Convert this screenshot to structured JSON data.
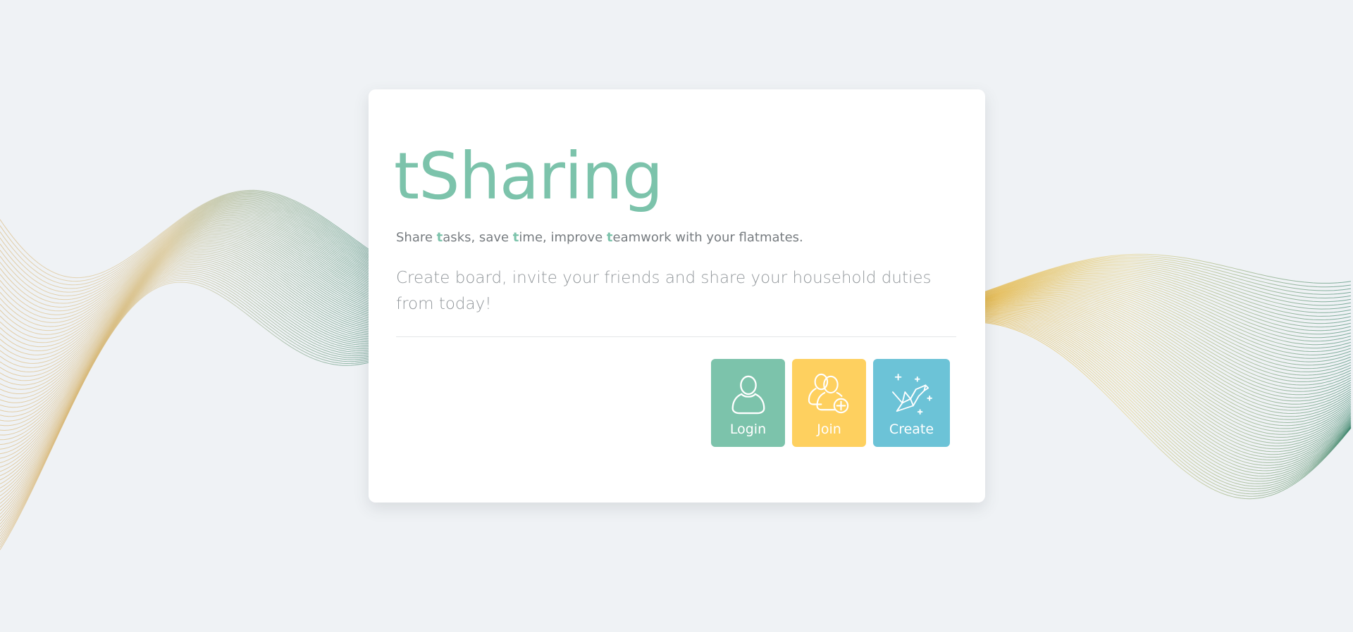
{
  "app": {
    "title": "tSharing"
  },
  "hero": {
    "tagline": [
      {
        "text": "Share ",
        "hl": false
      },
      {
        "text": "t",
        "hl": true
      },
      {
        "text": "asks, save ",
        "hl": false
      },
      {
        "text": "t",
        "hl": true
      },
      {
        "text": "ime, improve ",
        "hl": false
      },
      {
        "text": "t",
        "hl": true
      },
      {
        "text": "eamwork with your flatmates.",
        "hl": false
      }
    ],
    "lead": "Create board, invite your friends and share your household duties from today!"
  },
  "actions": {
    "login": {
      "label": "Login",
      "icon": "user-icon",
      "color": "#7cc3ab"
    },
    "join": {
      "label": "Join",
      "icon": "users-add-icon",
      "color": "#fed05f"
    },
    "create": {
      "label": "Create",
      "icon": "origami-crane-icon",
      "color": "#6cc3d7"
    }
  },
  "colors": {
    "background": "#eff2f5",
    "accent": "#7cc3ab",
    "wave_gold": "#d8b56a",
    "wave_green": "#2f7d62"
  }
}
